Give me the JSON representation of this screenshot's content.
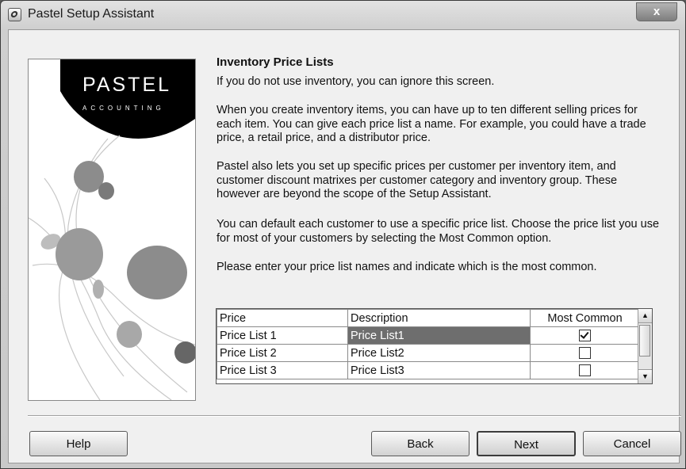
{
  "window": {
    "title": "Pastel Setup Assistant",
    "close_label": "x"
  },
  "logo": {
    "name": "PASTEL",
    "tagline": "ACCOUNTING"
  },
  "page": {
    "heading": "Inventory Price Lists",
    "paragraphs": [
      "If you do not use inventory, you can ignore this screen.",
      "When you create inventory items, you can have up to ten different selling prices for each item. You can give each price list a name. For example, you could have a trade price, a retail price, and a distributor price.",
      "Pastel also lets you set up specific prices per customer per inventory item, and customer discount matrixes per customer category and inventory group. These however are beyond the scope of the Setup Assistant.",
      "You can default each customer to use a specific price list. Choose the price list you use for most of your customers by selecting the Most Common option.",
      "Please enter your price list names and indicate which is the most common."
    ]
  },
  "price_grid": {
    "columns": [
      "Price",
      "Description",
      "Most Common"
    ],
    "rows": [
      {
        "price": "Price List 1",
        "description": "Price List1",
        "most_common": true
      },
      {
        "price": "Price List 2",
        "description": "Price List2",
        "most_common": false
      },
      {
        "price": "Price List 3",
        "description": "Price List3",
        "most_common": false
      }
    ]
  },
  "buttons": {
    "help": "Help",
    "back": "Back",
    "next": "Next",
    "cancel": "Cancel"
  }
}
